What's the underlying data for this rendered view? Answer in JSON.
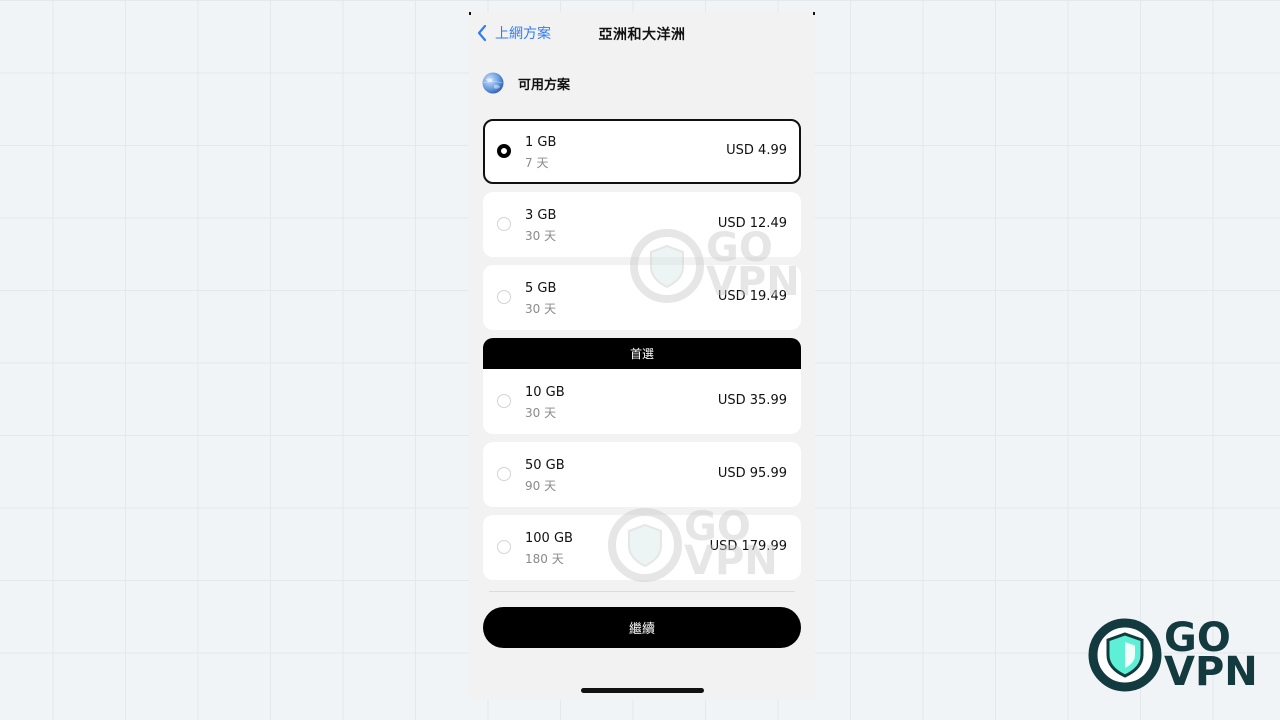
{
  "nav": {
    "back_label": "上網方案",
    "title": "亞洲和大洋洲"
  },
  "plans_header": {
    "label": "可用方案"
  },
  "plans": [
    {
      "size": "1 GB",
      "days": "7 天",
      "price": "USD 4.99",
      "selected": true
    },
    {
      "size": "3 GB",
      "days": "30 天",
      "price": "USD 12.49",
      "selected": false
    },
    {
      "size": "5 GB",
      "days": "30 天",
      "price": "USD 19.49",
      "selected": false
    },
    {
      "size": "10 GB",
      "days": "30 天",
      "price": "USD 35.99",
      "selected": false,
      "featured": true
    },
    {
      "size": "50 GB",
      "days": "90 天",
      "price": "USD 95.99",
      "selected": false
    },
    {
      "size": "100 GB",
      "days": "180 天",
      "price": "USD 179.99",
      "selected": false
    }
  ],
  "featured_label": "首選",
  "continue_label": "繼續",
  "brand": {
    "line1": "GO",
    "line2": "VPN",
    "dark_color": "#123a3f",
    "accent_color": "#5ef0d6"
  },
  "watermark": {
    "line1": "GO",
    "line2": "VPN"
  },
  "colors": {
    "link_blue": "#2f7cf6",
    "background": "#f2f2f2"
  },
  "icons": {
    "back": "chevron-left-icon",
    "globe": "globe-icon",
    "shield": "shield-icon"
  }
}
